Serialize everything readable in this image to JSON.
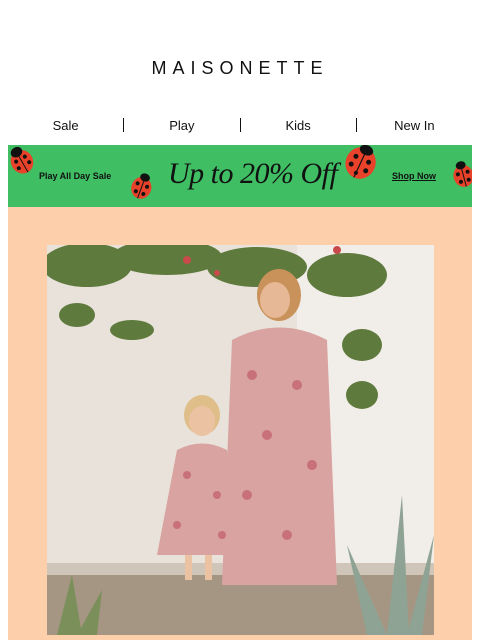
{
  "brand": {
    "logo": "MAISONETTE"
  },
  "nav": {
    "items": [
      "Sale",
      "Play",
      "Kids",
      "New In"
    ]
  },
  "banner": {
    "left_text": "Play All Day Sale",
    "headline": "Up to 20% Off",
    "cta": "Shop Now",
    "bg_color": "#3fbe63"
  },
  "hero": {
    "bg_color": "#fdcfab",
    "photo_subject": "mother-and-daughter-in-matching-floral-dresses"
  }
}
